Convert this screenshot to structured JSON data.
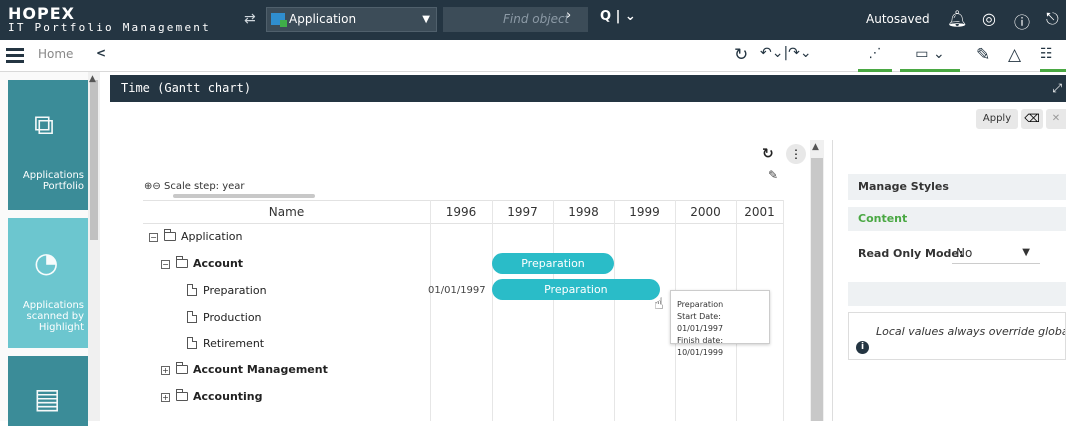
{
  "app": {
    "logo": "HOPEX",
    "subtitle": "IT Portfolio Management"
  },
  "topbar": {
    "context_value": "Application",
    "find_placeholder": "Find object",
    "autosaved": "Autosaved"
  },
  "toolbar": {
    "home": "Home"
  },
  "nav": {
    "tiles": [
      {
        "label": "Applications Portfolio",
        "color": "#3b8c98"
      },
      {
        "label": "Applications scanned by Highlight",
        "color": "#6cc6cf"
      },
      {
        "label": "",
        "color": "#3b8c98"
      }
    ]
  },
  "panel": {
    "title": "Time (Gantt chart)"
  },
  "actions": {
    "apply": "Apply"
  },
  "gantt": {
    "scale_step": "Scale step: year",
    "name_header": "Name",
    "years": [
      "1996",
      "1997",
      "1998",
      "1999",
      "2000",
      "2001"
    ],
    "rows": [
      {
        "label": "Application",
        "bold": false
      },
      {
        "label": "Account",
        "bold": true
      },
      {
        "label": "Preparation",
        "bold": false,
        "date": "01/01/1997"
      },
      {
        "label": "Production",
        "bold": false
      },
      {
        "label": "Retirement",
        "bold": false
      },
      {
        "label": "Account Management",
        "bold": true
      },
      {
        "label": "Accounting",
        "bold": true
      }
    ],
    "bars": [
      {
        "label": "Preparation",
        "start": 1997.0,
        "end": 1999.0
      },
      {
        "label": "Preparation",
        "start": 1997.0,
        "end": 1999.75
      }
    ],
    "tooltip": {
      "title": "Preparation",
      "start": "Start Date: 01/01/1997",
      "finish": "Finish date: 10/01/1999"
    }
  },
  "styles_panel": {
    "manage_styles": "Manage Styles",
    "content": "Content",
    "read_only_label": "Read Only Mode:",
    "read_only_value": "No",
    "info_text": "Local values always override globa"
  }
}
